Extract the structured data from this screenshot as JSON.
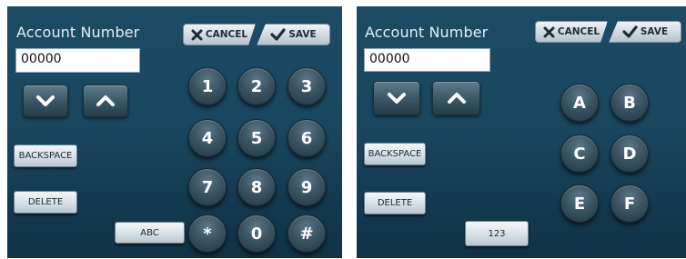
{
  "left": {
    "title": "Account Number",
    "value": "00000",
    "cancel_label": "CANCEL",
    "save_label": "SAVE",
    "backspace_label": "BACKSPACE",
    "delete_label": "DELETE",
    "mode_label": "ABC",
    "keys": [
      "1",
      "2",
      "3",
      "4",
      "5",
      "6",
      "7",
      "8",
      "9",
      "*",
      "0",
      "#"
    ]
  },
  "right": {
    "title": "Account Number",
    "value": "00000",
    "cancel_label": "CANCEL",
    "save_label": "SAVE",
    "backspace_label": "BACKSPACE",
    "delete_label": "DELETE",
    "mode_label": "123",
    "keys": [
      "A",
      "B",
      "C",
      "D",
      "E",
      "F"
    ]
  },
  "icons": {
    "cancel": "x-icon",
    "save": "checkmark-icon",
    "scroll_down": "chevron-down-icon",
    "scroll_up": "chevron-up-icon"
  },
  "colors": {
    "panel_top": "#1d4a64",
    "panel_bottom": "#0f3247",
    "key": "#3a5462",
    "title_text": "#e6eef3"
  }
}
